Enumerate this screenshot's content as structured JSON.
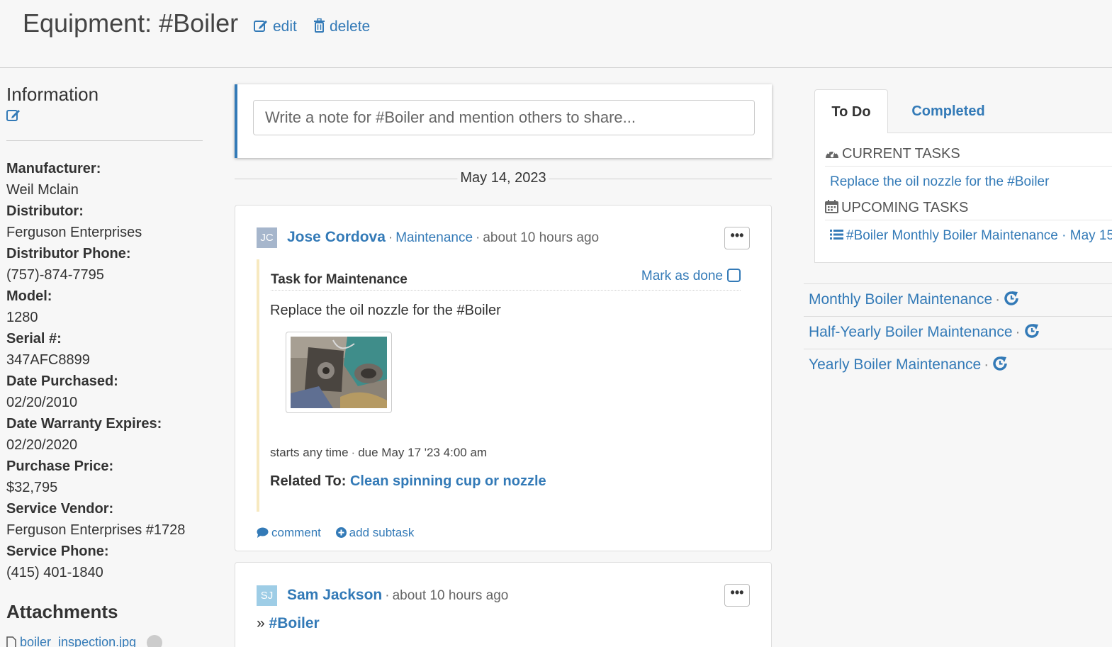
{
  "header": {
    "title": "Equipment: #Boiler",
    "edit_label": "edit",
    "delete_label": "delete"
  },
  "sidebar": {
    "info_title": "Information",
    "fields": [
      {
        "label": "Manufacturer:",
        "value": "Weil Mclain"
      },
      {
        "label": "Distributor:",
        "value": "Ferguson Enterprises"
      },
      {
        "label": "Distributor Phone:",
        "value": "(757)-874-7795"
      },
      {
        "label": "Model:",
        "value": "1280"
      },
      {
        "label": "Serial #:",
        "value": "347AFC8899"
      },
      {
        "label": "Date Purchased:",
        "value": "02/20/2010"
      },
      {
        "label": "Date Warranty Expires:",
        "value": "02/20/2020"
      },
      {
        "label": "Purchase Price:",
        "value": "$32,795"
      },
      {
        "label": "Service Vendor:",
        "value": "Ferguson Enterprises #1728"
      },
      {
        "label": "Service Phone:",
        "value": "(415) 401-1840"
      }
    ],
    "attachments_title": "Attachments",
    "attachment_name": "boiler_inspection.jpg"
  },
  "feed": {
    "note_placeholder": "Write a note for #Boiler and mention others to share...",
    "date_separator": "May 14, 2023",
    "post1": {
      "avatar_initials": "JC",
      "author": "Jose Cordova",
      "category": "Maintenance",
      "time": "about 10 hours ago",
      "more_label": "•••",
      "task_title": "Task for Maintenance",
      "mark_done_label": "Mark as done",
      "task_description": "Replace the oil nozzle for the #Boiler",
      "schedule_start": "starts any time",
      "schedule_due": "due May 17 '23 4:00 am",
      "related_label": "Related To:",
      "related_link": "Clean spinning cup or nozzle",
      "comment_label": "comment",
      "add_subtask_label": "add subtask"
    },
    "post2": {
      "avatar_initials": "SJ",
      "author": "Sam Jackson",
      "time": "about 10 hours ago",
      "more_label": "•••",
      "breadcrumb_prefix": "»",
      "breadcrumb_tag": "#Boiler"
    }
  },
  "tasks_panel": {
    "tabs": [
      {
        "label": "To Do",
        "active": true
      },
      {
        "label": "Completed",
        "active": false
      }
    ],
    "current_header": "CURRENT TASKS",
    "current_tasks": [
      "Replace the oil nozzle for the #Boiler"
    ],
    "upcoming_header": "UPCOMING TASKS",
    "upcoming_tasks": [
      "#Boiler Monthly Boiler Maintenance · May 15"
    ]
  },
  "recurring": [
    "Monthly Boiler Maintenance",
    "Half-Yearly Boiler Maintenance",
    "Yearly Boiler Maintenance"
  ],
  "colors": {
    "link": "#337ab7",
    "background": "#f7f7f7",
    "task_border": "#f7e9c0"
  }
}
